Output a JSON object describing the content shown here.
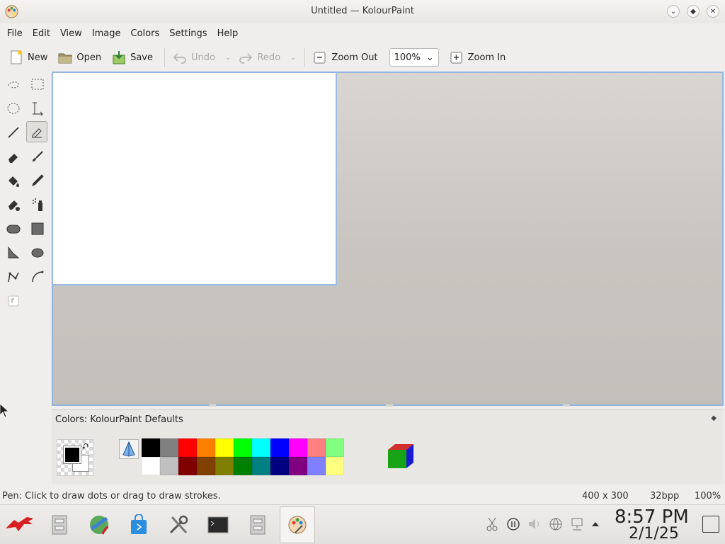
{
  "window": {
    "title": "Untitled — KolourPaint"
  },
  "menu": [
    "File",
    "Edit",
    "View",
    "Image",
    "Colors",
    "Settings",
    "Help"
  ],
  "toolbar": {
    "new_label": "New",
    "open_label": "Open",
    "save_label": "Save",
    "undo_label": "Undo",
    "redo_label": "Redo",
    "zoom_out_label": "Zoom Out",
    "zoom_value": "100%",
    "zoom_in_label": "Zoom In"
  },
  "tools": [
    "free-form-selection",
    "rectangular-selection",
    "elliptical-selection",
    "text",
    "line",
    "pen",
    "eraser",
    "brush",
    "flood-fill",
    "color-picker",
    "color-eraser",
    "spraycan",
    "rounded-rectangle",
    "rectangle",
    "polygon",
    "ellipse",
    "connected-lines",
    "curve",
    "small-option"
  ],
  "active_tool": "pen",
  "colors_panel": {
    "label_prefix": "Colors: ",
    "label_name": "KolourPaint Defaults"
  },
  "palette": {
    "row1": [
      "#000000",
      "#808080",
      "#ff0000",
      "#ff8000",
      "#ffff00",
      "#00ff00",
      "#00ffff",
      "#0000ff",
      "#ff00ff",
      "#ff8080",
      "#80ff80"
    ],
    "row2": [
      "#ffffff",
      "#c0c0c0",
      "#800000",
      "#804000",
      "#808000",
      "#008000",
      "#008080",
      "#000080",
      "#800080",
      "#8080ff",
      "#ffff80"
    ]
  },
  "foreground_color": "#000000",
  "background_color": "#ffffff",
  "status": {
    "message": "Pen: Click to draw dots or drag to draw strokes.",
    "size": "400 x 300",
    "depth": "32bpp",
    "zoom": "100%"
  },
  "clock": {
    "time": "8:57 PM",
    "date": "2/1/25"
  }
}
